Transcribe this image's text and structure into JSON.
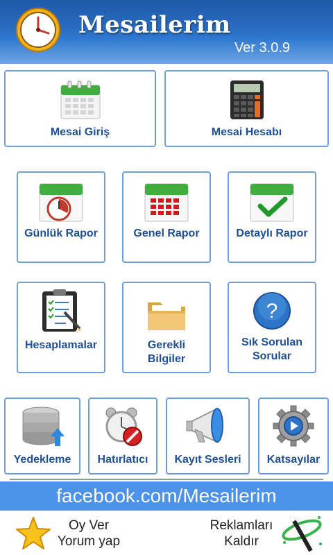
{
  "header": {
    "title": "Mesailerim",
    "version": "Ver 3.0.9"
  },
  "top_buttons": [
    {
      "label": "Mesai Giriş",
      "icon": "calendar-icon"
    },
    {
      "label": "Mesai Hesabı",
      "icon": "calculator-icon"
    }
  ],
  "report_buttons": [
    {
      "label": "Günlük Rapor",
      "icon": "calendar-clock-icon"
    },
    {
      "label": "Genel Rapor",
      "icon": "calendar-grid-icon"
    },
    {
      "label": "Detaylı Rapor",
      "icon": "calendar-check-icon"
    }
  ],
  "info_buttons": [
    {
      "label": "Hesaplamalar",
      "icon": "clipboard-checklist-icon"
    },
    {
      "label_line1": "Gerekli",
      "label_line2": "Bilgiler",
      "icon": "folder-icon"
    },
    {
      "label_line1": "Sık Sorulan",
      "label_line2": "Sorular",
      "icon": "question-icon"
    }
  ],
  "bottom_buttons": [
    {
      "label": "Yedekleme",
      "icon": "database-backup-icon"
    },
    {
      "label": "Hatırlatıcı",
      "icon": "alarm-clock-icon"
    },
    {
      "label": "Kayıt Sesleri",
      "icon": "megaphone-icon"
    },
    {
      "label": "Katsayılar",
      "icon": "gear-icon"
    }
  ],
  "facebook_banner": "facebook.com/Mesailerim",
  "footer": {
    "rate_line1": "Oy Ver",
    "rate_line2": "Yorum yap",
    "remove_ads_line1": "Reklamları",
    "remove_ads_line2": "Kaldır"
  },
  "colors": {
    "header_blue": "#2a6cc2",
    "tile_border": "#6f9fd8",
    "label_blue": "#1f4f96",
    "banner_blue": "#4c92e8",
    "calendar_green": "#3fae3f"
  }
}
